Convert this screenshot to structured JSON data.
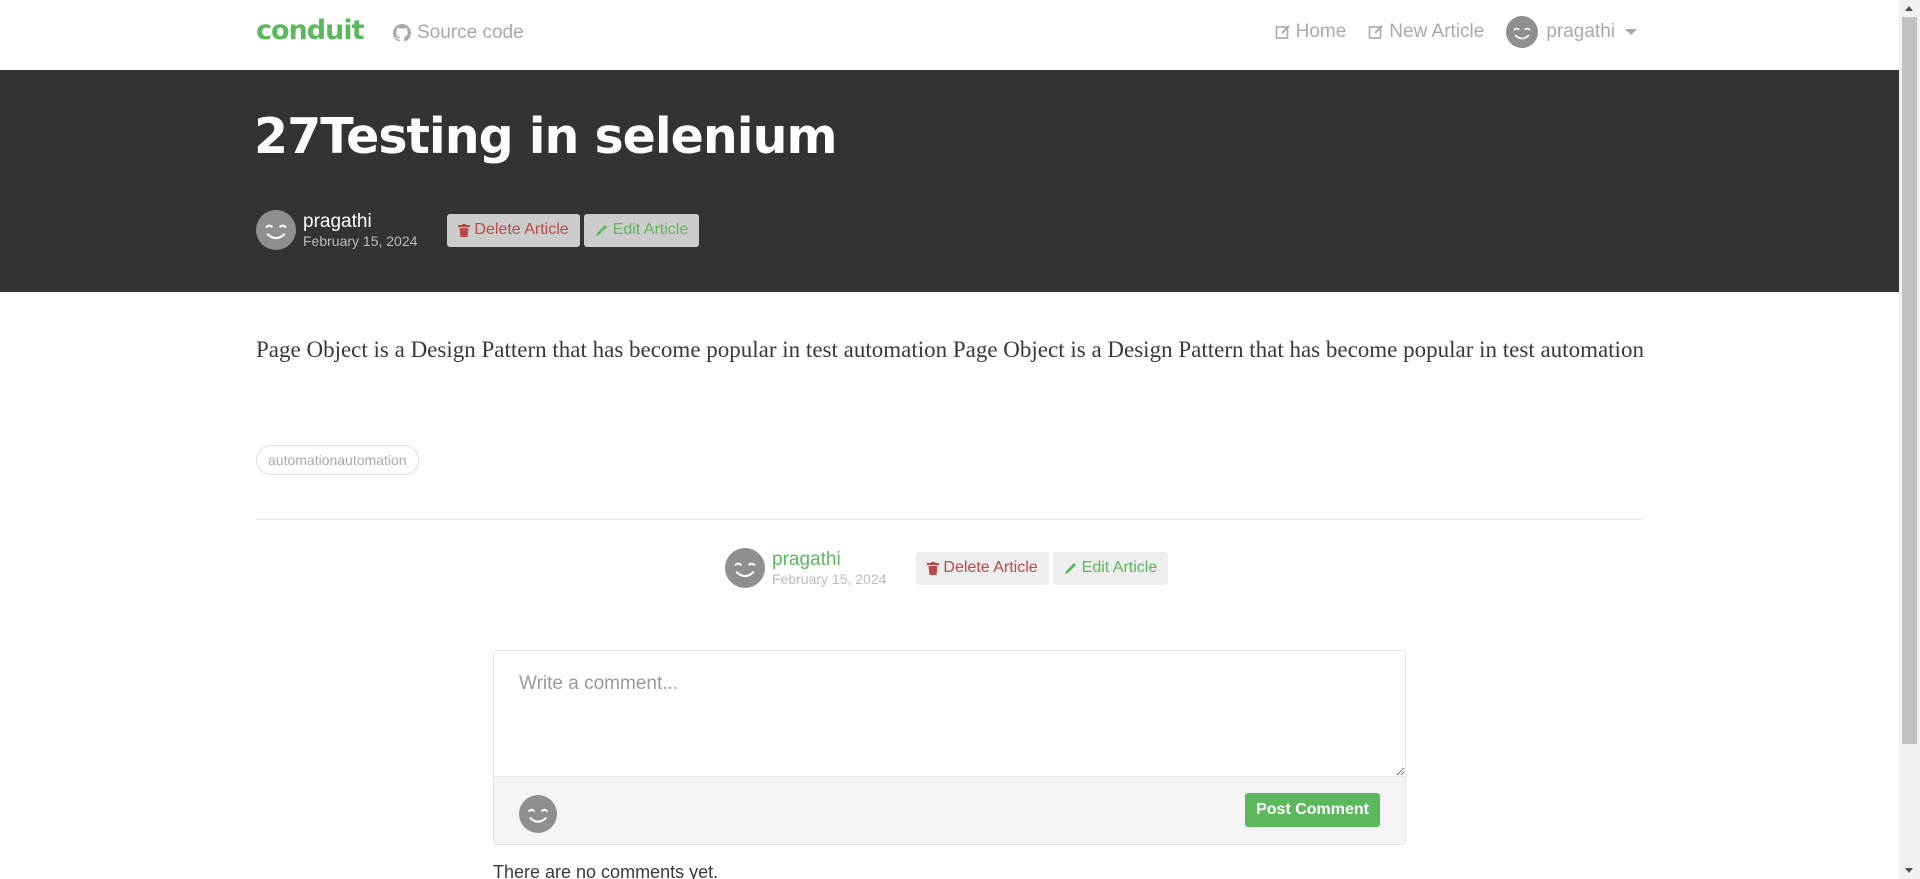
{
  "navbar": {
    "brand": "conduit",
    "source_label": "Source code",
    "home_label": "Home",
    "new_article_label": "New Article",
    "username": "pragathi"
  },
  "article": {
    "title": "27Testing in selenium",
    "author": "pragathi",
    "date": "February 15, 2024",
    "delete_label": "Delete Article",
    "edit_label": "Edit Article",
    "body": "Page Object is a Design Pattern that has become popular in test automation Page Object is a Design Pattern that has become popular in test automation",
    "tags": [
      "automationautomation"
    ]
  },
  "comment_form": {
    "placeholder": "Write a comment...",
    "post_label": "Post Comment"
  },
  "comments": {
    "empty_text": "There are no comments yet."
  },
  "colors": {
    "brand": "#5cb85c",
    "banner_bg": "#333333",
    "danger": "#b84a4a"
  }
}
